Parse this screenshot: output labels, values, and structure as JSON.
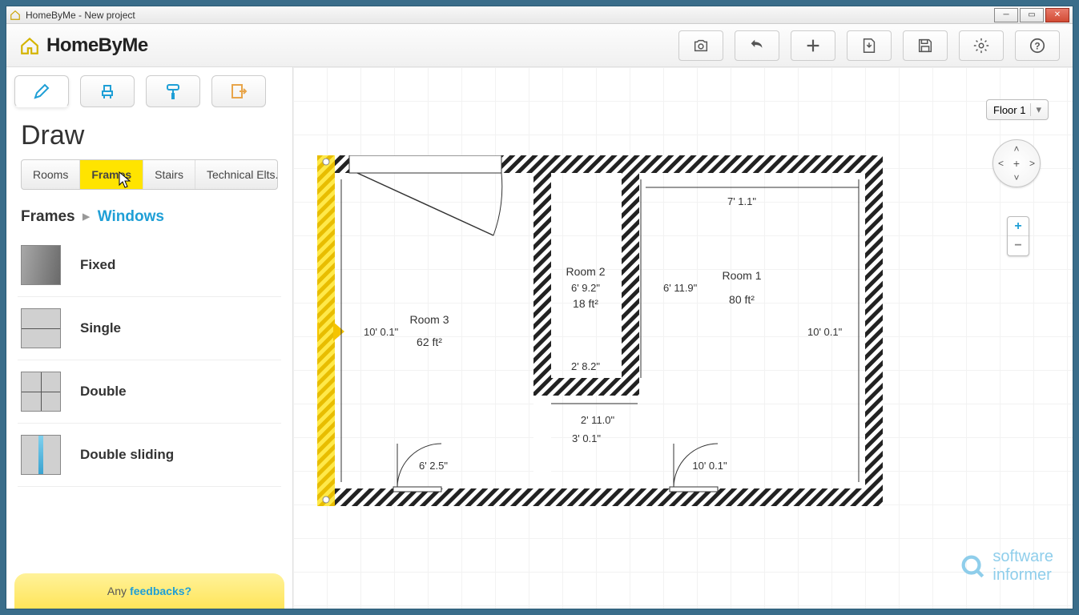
{
  "window": {
    "title": "HomeByMe - New project"
  },
  "brand": {
    "name": "HomeByMe"
  },
  "toolbar": {
    "screenshot": "camera",
    "undo": "undo",
    "add": "add",
    "import": "import",
    "save": "save",
    "settings": "settings",
    "help": "help"
  },
  "sidebar": {
    "title": "Draw",
    "modes": [
      "Draw",
      "Furnish",
      "Paint",
      "Export"
    ],
    "active_mode": 0,
    "categories": [
      {
        "label": "Rooms"
      },
      {
        "label": "Frames"
      },
      {
        "label": "Stairs"
      },
      {
        "label": "Technical Elts."
      }
    ],
    "active_category": 1,
    "breadcrumb": {
      "root": "Frames",
      "leaf": "Windows"
    },
    "items": [
      {
        "label": "Fixed",
        "kind": "fixed"
      },
      {
        "label": "Single",
        "kind": "single"
      },
      {
        "label": "Double",
        "kind": "double"
      },
      {
        "label": "Double sliding",
        "kind": "sliding"
      }
    ],
    "feedback_prefix": "Any",
    "feedback_link": "feedbacks?"
  },
  "canvas": {
    "floor_label": "Floor 1",
    "rooms": [
      {
        "name": "Room 1",
        "area": "80 ft²"
      },
      {
        "name": "Room 2",
        "width": "6' 9.2\"",
        "area": "18 ft²"
      },
      {
        "name": "Room 3",
        "area": "62 ft²"
      }
    ],
    "dimensions": {
      "room3_height": "10' 0.1\"",
      "room1_height_right": "10' 0.1\"",
      "room1_top_width": "7' 1.1\"",
      "room2_left_height": "6' 11.9\"",
      "room2_bottom_width": "2' 8.2\"",
      "corridor_width": "2' 11.0\"",
      "corridor_height": "3' 0.1\"",
      "door_left": "6' 2.5\"",
      "door_right": "10' 0.1\""
    }
  },
  "watermark": {
    "line1": "software",
    "line2": "informer"
  }
}
